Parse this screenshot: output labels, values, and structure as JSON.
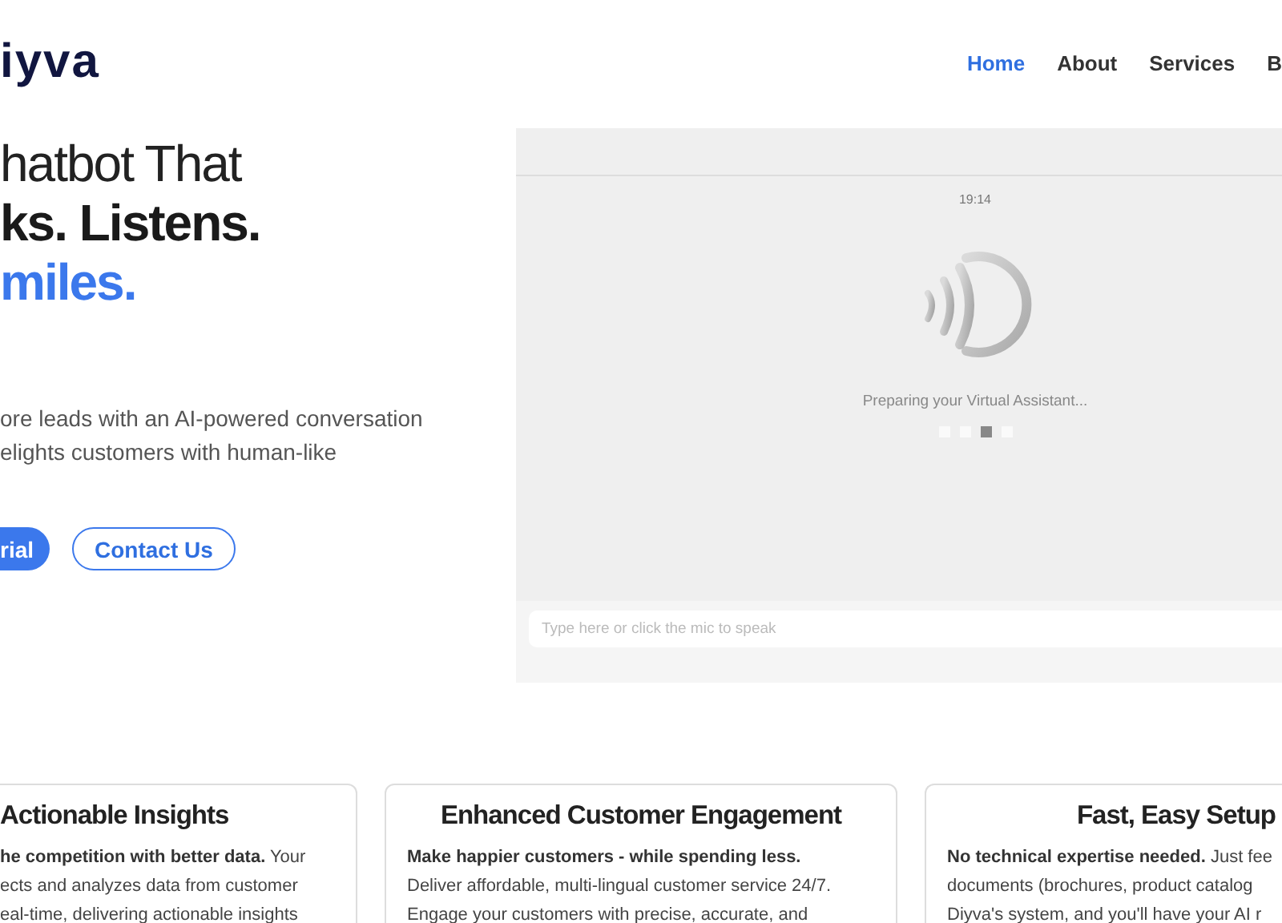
{
  "header": {
    "logo": "iyva",
    "nav": [
      {
        "label": "Home",
        "selected": true
      },
      {
        "label": "About",
        "selected": false
      },
      {
        "label": "Services",
        "selected": false
      },
      {
        "label": "B",
        "selected": false
      }
    ]
  },
  "hero": {
    "headline": [
      {
        "text": "hatbot That",
        "kind": "light"
      },
      {
        "text": "ks. Listens.",
        "kind": "bold"
      },
      {
        "text": "miles.",
        "kind": "accent"
      }
    ],
    "description": [
      "ore leads with an AI-powered conversation",
      "elights customers with human-like"
    ],
    "buttons": [
      {
        "label": "rial",
        "kind": "primary"
      },
      {
        "label": "Contact Us",
        "kind": "outline"
      }
    ]
  },
  "chat": {
    "time": "19:14",
    "status": "Preparing your Virtual Assistant...",
    "dots": [
      {
        "selected": false
      },
      {
        "selected": false
      },
      {
        "selected": true
      },
      {
        "selected": false
      }
    ],
    "input": {
      "placeholder": "Type here or click the mic to speak"
    }
  },
  "cards": [
    {
      "title": "Actionable Insights",
      "lines": [
        "**he competition with better data.** Your",
        "ects and analyzes data from customer",
        "eal-time, delivering actionable insights"
      ]
    },
    {
      "title": "Enhanced Customer Engagement",
      "lines": [
        "**Make happier customers - while spending less.**",
        "Deliver affordable, multi-lingual customer service 24/7.",
        "Engage your customers with precise, accurate, and"
      ]
    },
    {
      "title": "Fast, Easy Setup",
      "lines": [
        "**No technical expertise needed.** Just fee",
        "documents (brochures, product catalog",
        "Diyva's system, and you'll have your AI r"
      ]
    }
  ]
}
